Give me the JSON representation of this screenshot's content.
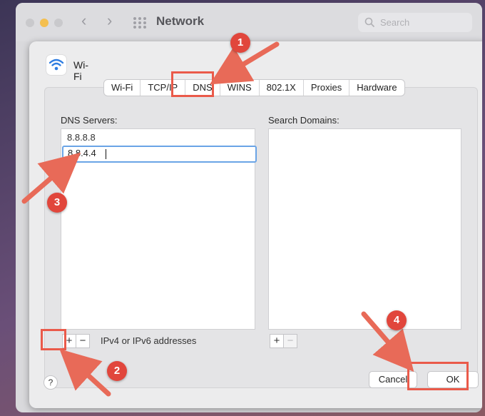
{
  "window": {
    "title": "Network",
    "search_placeholder": "Search"
  },
  "sheet": {
    "interface_label": "Wi-Fi",
    "tabs": [
      {
        "label": "Wi-Fi"
      },
      {
        "label": "TCP/IP"
      },
      {
        "label": "DNS",
        "selected": true
      },
      {
        "label": "WINS"
      },
      {
        "label": "802.1X"
      },
      {
        "label": "Proxies"
      },
      {
        "label": "Hardware"
      }
    ],
    "dns_servers": {
      "label": "DNS Servers:",
      "entries": [
        "8.8.8.8"
      ],
      "editing_value": "8.8.4.4",
      "hint": "IPv4 or IPv6 addresses"
    },
    "search_domains": {
      "label": "Search Domains:"
    },
    "buttons": {
      "add": "+",
      "remove": "−",
      "help": "?",
      "cancel": "Cancel",
      "ok": "OK"
    }
  },
  "annotations": {
    "color": "#e1463c",
    "steps": [
      "1",
      "2",
      "3",
      "4"
    ]
  }
}
